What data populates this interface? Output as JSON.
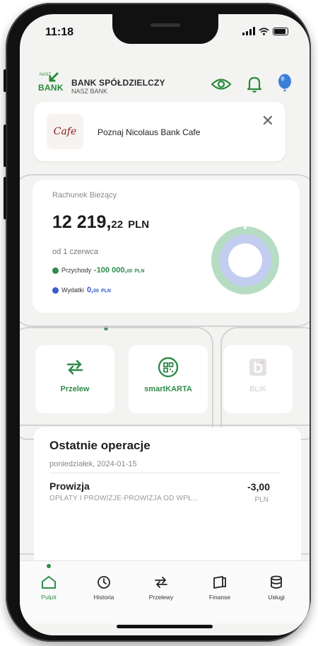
{
  "status": {
    "time": "11:18"
  },
  "header": {
    "logo_small": "NASZ",
    "logo_bank": "BANK",
    "bank_name": "BANK SPÓŁDZIELCZY",
    "bank_sub": "NASZ BANK",
    "icons": [
      "eye-icon",
      "bell-icon",
      "balloon-icon"
    ]
  },
  "promo": {
    "logo_text": "Cafe",
    "text": "Poznaj Nicolaus Bank Cafe",
    "close": "✕"
  },
  "account": {
    "label": "Rachunek Bieżący",
    "balance_main": "12 219,",
    "balance_dec": "22",
    "currency": "PLN",
    "since": "od 1 czerwca",
    "income_label": "Przychody",
    "income_value": "-100 000,",
    "income_dec": "00",
    "income_cur": "PLN",
    "expense_label": "Wydatki",
    "expense_value": "0,",
    "expense_dec": "00",
    "expense_cur": "PLN",
    "colors": {
      "income": "#2e8b4a",
      "expense": "#3a5bcc"
    }
  },
  "actions": [
    {
      "label": "Przelew",
      "icon": "transfer-icon"
    },
    {
      "label": "smartKARTA",
      "icon": "qr-card-icon"
    },
    {
      "label": "BLIK",
      "icon": "blik-icon",
      "disabled": true
    }
  ],
  "operations": {
    "title": "Ostatnie operacje",
    "date": "poniedziałek, 2024-01-15",
    "items": [
      {
        "title": "Prowizja",
        "desc": "OPŁATY I PROWIZJE-PROWIZJA OD WPŁ...",
        "amount": "-3,00",
        "currency": "PLN"
      }
    ]
  },
  "nav": {
    "items": [
      {
        "label": "Pulpit",
        "icon": "home-icon",
        "active": true
      },
      {
        "label": "Historia",
        "icon": "history-icon"
      },
      {
        "label": "Przelewy",
        "icon": "transfers-icon"
      },
      {
        "label": "Finanse",
        "icon": "finance-icon"
      },
      {
        "label": "Usługi",
        "icon": "services-icon"
      }
    ]
  }
}
